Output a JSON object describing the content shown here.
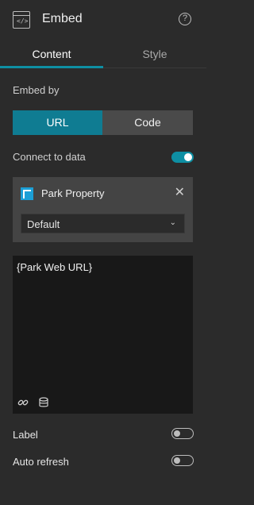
{
  "header": {
    "title": "Embed",
    "widget_icon": "embed-widget-icon",
    "help_icon": "help-icon"
  },
  "tabs": [
    {
      "label": "Content"
    },
    {
      "label": "Style"
    }
  ],
  "embed_by": {
    "label": "Embed by",
    "options": [
      "URL",
      "Code"
    ],
    "selected": "URL"
  },
  "connect": {
    "label": "Connect to data",
    "enabled": true
  },
  "data_source": {
    "name": "Park Property",
    "view": "Default"
  },
  "editor": {
    "content": "{Park Web URL}"
  },
  "label_toggle": {
    "label": "Label",
    "enabled": false
  },
  "auto_refresh": {
    "label": "Auto refresh",
    "enabled": false
  },
  "colors": {
    "accent": "#0e8fa3",
    "selected_segment": "#0f7c92",
    "background": "#2b2b2b"
  }
}
